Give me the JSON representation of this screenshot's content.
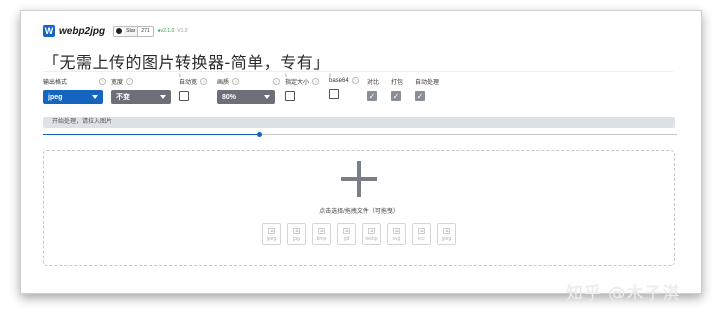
{
  "header": {
    "logo_glyph": "W",
    "brand": "webp2jpg",
    "github": {
      "star_label": "Star",
      "count": "271"
    },
    "version": "●v2.1.0",
    "version_alt": "V1.0"
  },
  "tagline": "「无需上传的图片转换器-简单，专有」",
  "options": {
    "output_format": {
      "label": "输出格式",
      "value": "jpeg",
      "color": "#1565c0"
    },
    "width": {
      "label": "宽度",
      "value": "不变",
      "color": "#6b7078"
    },
    "auto_width": {
      "label": "自动宽",
      "checked": false,
      "mark": "ℹ"
    },
    "quality": {
      "label": "画质",
      "value": "80%",
      "color": "#6b7078"
    },
    "fixed_size": {
      "label": "指定大小",
      "checked": false,
      "mark": "ℹ"
    },
    "base64": {
      "label": "base64",
      "checked": false,
      "mark": "ℹ"
    },
    "compare": {
      "label": "对比",
      "checked": true
    },
    "pack": {
      "label": "打包",
      "checked": true
    },
    "auto_process": {
      "label": "自动处理",
      "checked": true
    }
  },
  "status_text": "开始处理，请拉入图片",
  "slider": {
    "value_fraction": 0.34,
    "color": "#1565c0"
  },
  "dropzone": {
    "hint": "点击选择/拖拽文件（可拖曳）",
    "formats": [
      "jpeg",
      "jpg",
      "bmp",
      "gif",
      "webp",
      "svg",
      "ico",
      "jpeg"
    ]
  },
  "watermark": "知乎 @木子淇"
}
